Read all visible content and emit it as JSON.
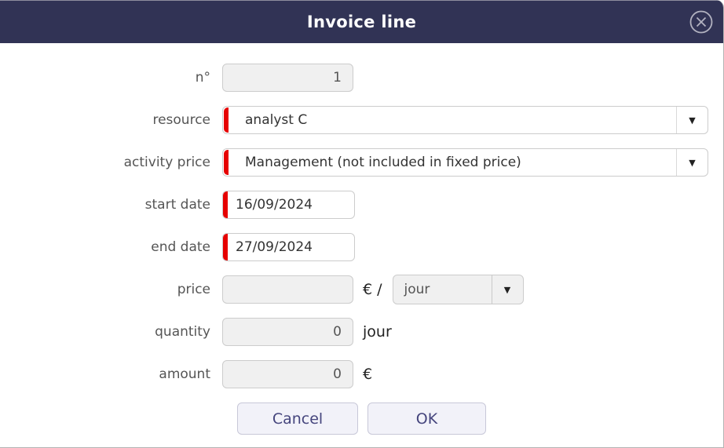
{
  "dialog": {
    "title": "Invoice line"
  },
  "colors": {
    "header_bg": "#313355",
    "required_marker_red": "#e60000",
    "readonly_field_bg": "#f0f0f0",
    "button_text": "#45457d"
  },
  "fields": {
    "number": {
      "label": "n°",
      "value": "1"
    },
    "resource": {
      "label": "resource",
      "value": "analyst C"
    },
    "activity_price": {
      "label": "activity price",
      "value": "Management (not included in fixed price)"
    },
    "start_date": {
      "label": "start date",
      "value": "16/09/2024"
    },
    "end_date": {
      "label": "end date",
      "value": "27/09/2024"
    },
    "price": {
      "label": "price",
      "value": "",
      "suffix": "€ /",
      "unit": "jour"
    },
    "quantity": {
      "label": "quantity",
      "value": "0",
      "suffix": "jour"
    },
    "amount": {
      "label": "amount",
      "value": "0",
      "suffix": "€"
    }
  },
  "buttons": {
    "cancel": "Cancel",
    "ok": "OK"
  }
}
